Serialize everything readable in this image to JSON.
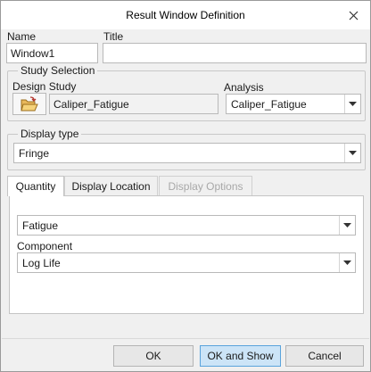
{
  "window": {
    "title": "Result Window Definition",
    "close_icon": "close-icon"
  },
  "name": {
    "label": "Name",
    "value": "Window1"
  },
  "title_field": {
    "label": "Title",
    "value": ""
  },
  "study_selection": {
    "legend": "Study Selection",
    "design_study_label": "Design Study",
    "design_study_value": "Caliper_Fatigue",
    "open_icon": "folder-open-icon",
    "analysis_label": "Analysis",
    "analysis_value": "Caliper_Fatigue"
  },
  "display_type": {
    "legend": "Display type",
    "value": "Fringe"
  },
  "tabs": [
    {
      "label": "Quantity",
      "state": "active"
    },
    {
      "label": "Display Location",
      "state": "normal"
    },
    {
      "label": "Display Options",
      "state": "disabled"
    }
  ],
  "quantity_panel": {
    "quantity_value": "Fatigue",
    "component_label": "Component",
    "component_value": "Log Life"
  },
  "buttons": {
    "ok": "OK",
    "ok_and_show": "OK and Show",
    "cancel": "Cancel"
  },
  "colors": {
    "primary_button_bg": "#cce4f7",
    "primary_button_border": "#5aa3dc",
    "dialog_bg": "#f0f0f0"
  }
}
